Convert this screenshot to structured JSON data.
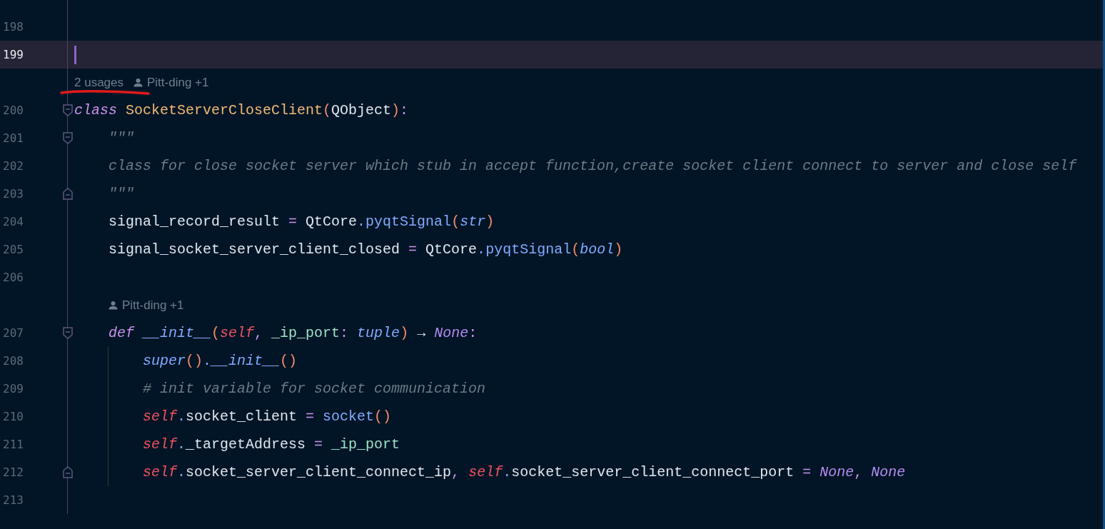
{
  "editor": {
    "rows": [
      {
        "kind": "code",
        "number": "198",
        "current": false,
        "tokens": []
      },
      {
        "kind": "code",
        "number": "199",
        "current": true,
        "tokens": []
      },
      {
        "kind": "inlay",
        "nested": false,
        "usages": "2 usages",
        "author": "Pitt-ding +1"
      },
      {
        "kind": "code",
        "number": "200",
        "current": false,
        "fold_start": true,
        "tokens": [
          {
            "text": "class ",
            "kind": "keyword"
          },
          {
            "text": "SocketServerCloseClient",
            "kind": "class-name"
          },
          {
            "text": "(",
            "kind": "paren"
          },
          {
            "text": "QObject",
            "kind": "plain"
          },
          {
            "text": ")",
            "kind": "paren"
          },
          {
            "text": ":",
            "kind": "punct"
          }
        ]
      },
      {
        "kind": "code",
        "number": "201",
        "current": false,
        "fold_start": true,
        "tokens": [
          {
            "text": "    \"\"\"",
            "kind": "docstring"
          }
        ]
      },
      {
        "kind": "code",
        "number": "202",
        "current": false,
        "tokens": [
          {
            "text": "    class for close socket server which stub in accept function,create socket client connect to server and close self",
            "kind": "docstring"
          }
        ]
      },
      {
        "kind": "code",
        "number": "203",
        "current": false,
        "fold_end": true,
        "tokens": [
          {
            "text": "    \"\"\"",
            "kind": "docstring"
          }
        ]
      },
      {
        "kind": "code",
        "number": "204",
        "current": false,
        "tokens": [
          {
            "text": "    signal_record_result",
            "kind": "plain"
          },
          {
            "text": " = ",
            "kind": "operator"
          },
          {
            "text": "QtCore",
            "kind": "plain"
          },
          {
            "text": ".",
            "kind": "dot"
          },
          {
            "text": "pyqtSignal",
            "kind": "function"
          },
          {
            "text": "(",
            "kind": "paren"
          },
          {
            "text": "str",
            "kind": "type"
          },
          {
            "text": ")",
            "kind": "paren"
          }
        ]
      },
      {
        "kind": "code",
        "number": "205",
        "current": false,
        "tokens": [
          {
            "text": "    signal_socket_server_client_closed",
            "kind": "plain"
          },
          {
            "text": " = ",
            "kind": "operator"
          },
          {
            "text": "QtCore",
            "kind": "plain"
          },
          {
            "text": ".",
            "kind": "dot"
          },
          {
            "text": "pyqtSignal",
            "kind": "function"
          },
          {
            "text": "(",
            "kind": "paren"
          },
          {
            "text": "bool",
            "kind": "type"
          },
          {
            "text": ")",
            "kind": "paren"
          }
        ]
      },
      {
        "kind": "code",
        "number": "206",
        "current": false,
        "tokens": []
      },
      {
        "kind": "inlay",
        "nested": true,
        "author": "Pitt-ding +1"
      },
      {
        "kind": "code",
        "number": "207",
        "current": false,
        "fold_start": true,
        "tokens": [
          {
            "text": "    def ",
            "kind": "keyword"
          },
          {
            "text": "__init__",
            "kind": "magic"
          },
          {
            "text": "(",
            "kind": "paren"
          },
          {
            "text": "self",
            "kind": "self"
          },
          {
            "text": ", ",
            "kind": "punct"
          },
          {
            "text": "_ip_port",
            "kind": "param"
          },
          {
            "text": ": ",
            "kind": "punct"
          },
          {
            "text": "tuple",
            "kind": "type"
          },
          {
            "text": ")",
            "kind": "paren"
          },
          {
            "text": " → ",
            "kind": "plain"
          },
          {
            "text": "None",
            "kind": "constant"
          },
          {
            "text": ":",
            "kind": "punct"
          }
        ]
      },
      {
        "kind": "code",
        "number": "208",
        "current": false,
        "guide": true,
        "tokens": [
          {
            "text": "        super",
            "kind": "builtin"
          },
          {
            "text": "()",
            "kind": "paren"
          },
          {
            "text": ".",
            "kind": "dot"
          },
          {
            "text": "__init__",
            "kind": "builtin"
          },
          {
            "text": "()",
            "kind": "paren"
          }
        ]
      },
      {
        "kind": "code",
        "number": "209",
        "current": false,
        "guide": true,
        "tokens": [
          {
            "text": "        # init variable for socket communication",
            "kind": "comment"
          }
        ]
      },
      {
        "kind": "code",
        "number": "210",
        "current": false,
        "guide": true,
        "tokens": [
          {
            "text": "        self",
            "kind": "self"
          },
          {
            "text": ".",
            "kind": "dot"
          },
          {
            "text": "socket_client",
            "kind": "plain"
          },
          {
            "text": " = ",
            "kind": "operator"
          },
          {
            "text": "socket",
            "kind": "function"
          },
          {
            "text": "()",
            "kind": "paren"
          }
        ]
      },
      {
        "kind": "code",
        "number": "211",
        "current": false,
        "guide": true,
        "tokens": [
          {
            "text": "        self",
            "kind": "self"
          },
          {
            "text": ".",
            "kind": "dot"
          },
          {
            "text": "_targetAddress",
            "kind": "plain"
          },
          {
            "text": " = ",
            "kind": "operator"
          },
          {
            "text": "_ip_port",
            "kind": "param"
          }
        ]
      },
      {
        "kind": "code",
        "number": "212",
        "current": false,
        "guide": true,
        "fold_end": true,
        "tokens": [
          {
            "text": "        self",
            "kind": "self"
          },
          {
            "text": ".",
            "kind": "dot"
          },
          {
            "text": "socket_server_client_connect_ip",
            "kind": "plain"
          },
          {
            "text": ", ",
            "kind": "punct"
          },
          {
            "text": "self",
            "kind": "self"
          },
          {
            "text": ".",
            "kind": "dot"
          },
          {
            "text": "socket_server_client_connect_port",
            "kind": "plain"
          },
          {
            "text": " = ",
            "kind": "operator"
          },
          {
            "text": "None",
            "kind": "constant"
          },
          {
            "text": ", ",
            "kind": "punct"
          },
          {
            "text": "None",
            "kind": "constant"
          }
        ]
      },
      {
        "kind": "code",
        "number": "213",
        "current": false,
        "tokens": []
      }
    ]
  }
}
